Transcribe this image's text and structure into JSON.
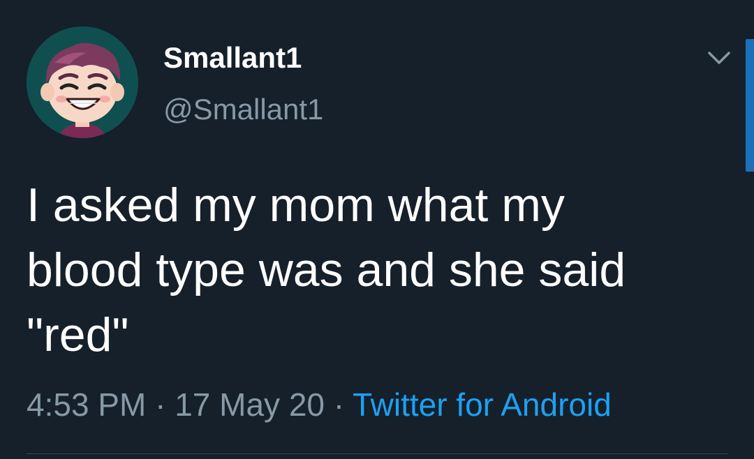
{
  "tweet": {
    "display_name": "Smallant1",
    "handle": "@Smallant1",
    "text_lines": [
      "I asked my mom what my",
      "blood type was and she said",
      "\"red\""
    ],
    "time": "4:53 PM",
    "separator": " · ",
    "date": "17 May 20",
    "source": "Twitter for Android"
  },
  "icons": {
    "avatar": "cartoon-avatar-icon",
    "menu": "chevron-down-icon"
  },
  "colors": {
    "background": "#15202b",
    "primary_text": "#ffffff",
    "secondary_text": "#8899a6",
    "link": "#1da1f2",
    "scrollbar": "#1d6fb8",
    "avatar_bg": "#0f4f50"
  }
}
